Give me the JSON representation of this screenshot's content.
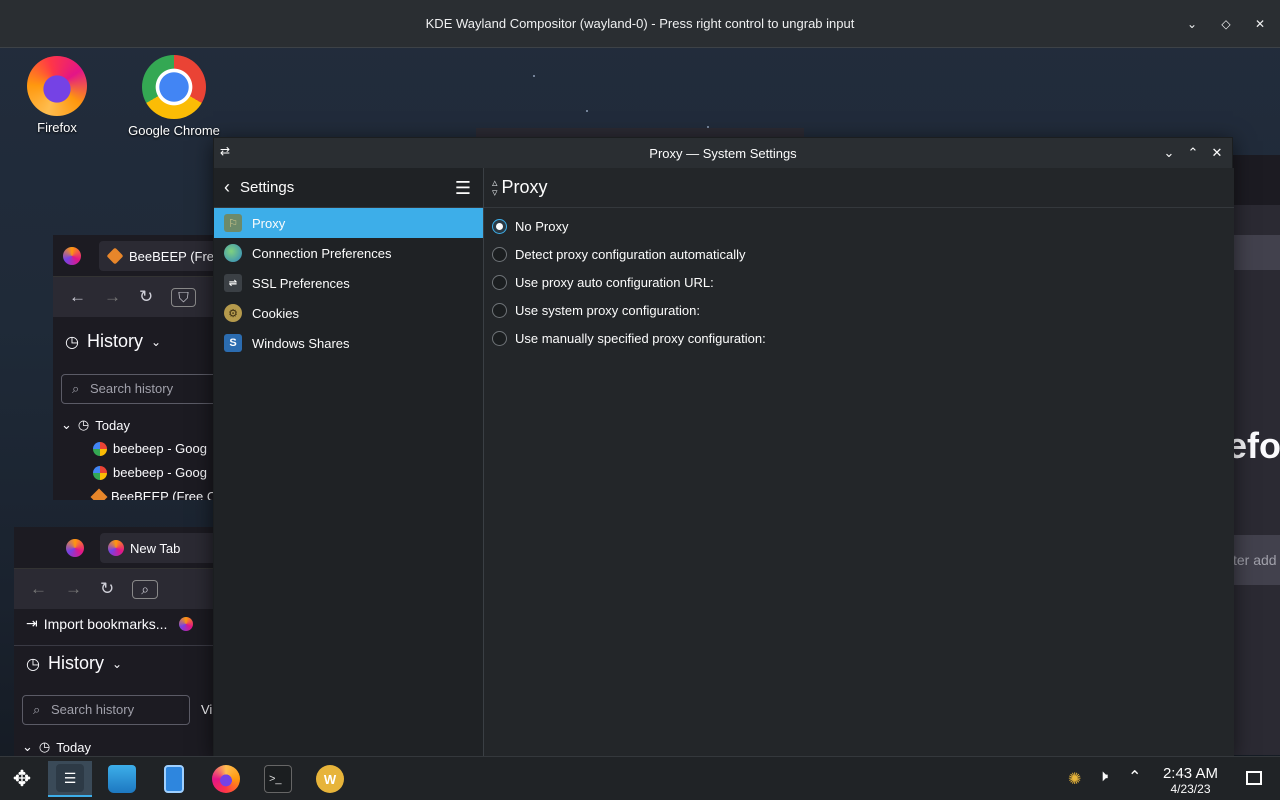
{
  "compositor": {
    "title": "KDE Wayland Compositor (wayland-0) - Press right control to ungrab input"
  },
  "desktop_icons": [
    {
      "label": "Firefox",
      "icon": "firefox-icon"
    },
    {
      "label": "Google Chrome",
      "icon": "chrome-icon"
    }
  ],
  "bg_window_1": {
    "tab_label": "BeeBEEP (Fre",
    "sidebar_title": "History",
    "search_placeholder": "Search history",
    "group": "Today",
    "rows": [
      "beebeep - Goog",
      "beebeep - Goog",
      "BeeBEEP (Free C"
    ]
  },
  "bg_window_2": {
    "tab_label": "New Tab",
    "bookmark_label": "Import bookmarks...",
    "sidebar_title": "History",
    "search_placeholder": "Search history",
    "view_label": "Vi",
    "group": "Today"
  },
  "right_window": {
    "text_big": "efox",
    "text_addr": "ter add"
  },
  "settings": {
    "window_title": "Proxy — System Settings",
    "sidebar_title": "Settings",
    "sidebar_items": [
      {
        "label": "Proxy",
        "icon": "proxy-icon",
        "selected": true
      },
      {
        "label": "Connection Preferences",
        "icon": "globe-icon",
        "selected": false
      },
      {
        "label": "SSL Preferences",
        "icon": "ssl-icon",
        "selected": false
      },
      {
        "label": "Cookies",
        "icon": "cookie-icon",
        "selected": false
      },
      {
        "label": "Windows Shares",
        "icon": "shares-icon",
        "selected": false
      }
    ],
    "page_title": "Proxy",
    "options": [
      {
        "label": "No Proxy",
        "checked": true
      },
      {
        "label": "Detect proxy configuration automatically",
        "checked": false
      },
      {
        "label": "Use proxy auto configuration URL:",
        "checked": false
      },
      {
        "label": "Use system proxy configuration:",
        "checked": false
      },
      {
        "label": "Use manually specified proxy configuration:",
        "checked": false
      }
    ]
  },
  "taskbar": {
    "apps": [
      "app-launcher",
      "system-settings",
      "discover",
      "file-manager",
      "firefox",
      "konsole",
      "beebeep"
    ],
    "time": "2:43 AM",
    "date": "4/23/23"
  },
  "colors": {
    "accent": "#3daee9",
    "panel": "#232629"
  }
}
